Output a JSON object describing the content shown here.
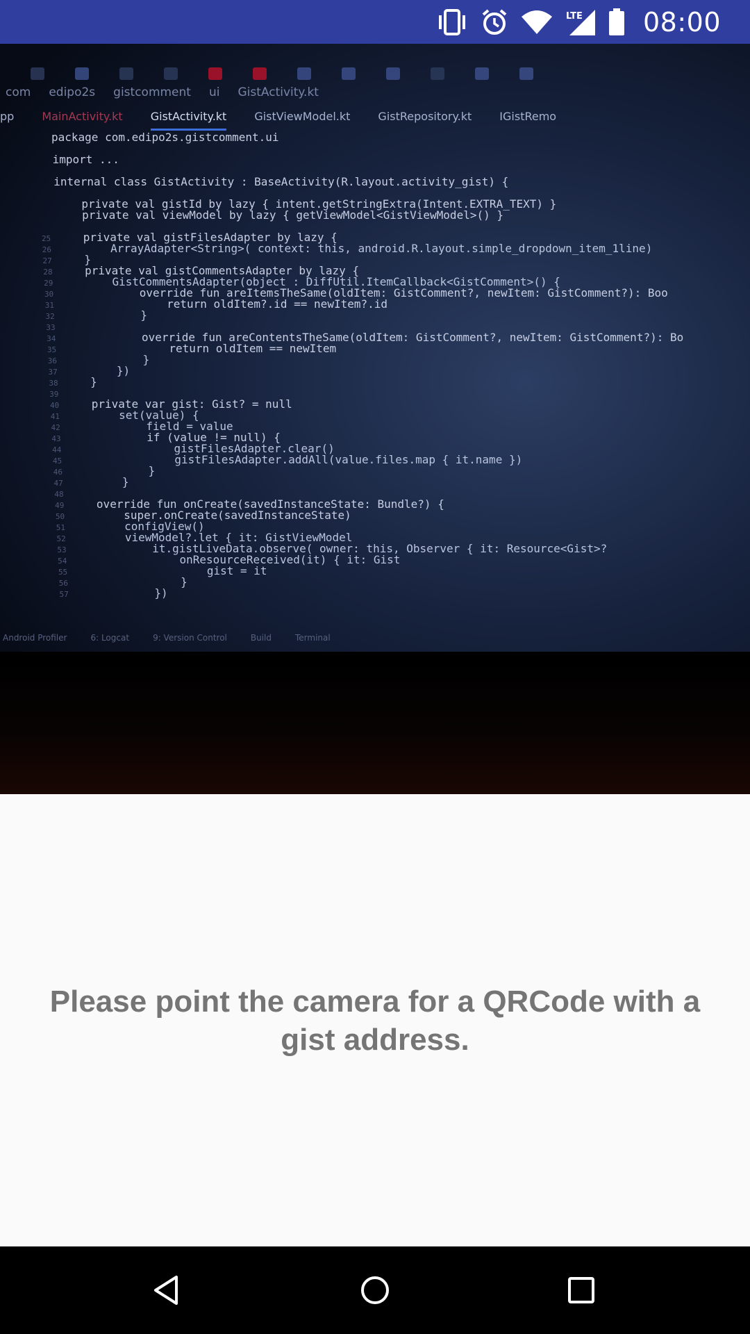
{
  "status_bar": {
    "time": "08:00",
    "icons": [
      "vibrate-icon",
      "alarm-icon",
      "wifi-icon",
      "lte-signal-icon",
      "battery-icon"
    ],
    "network_label": "LTE",
    "background_color": "#303f9f"
  },
  "camera_preview": {
    "toolbar_run_config": "app",
    "breadcrumbs": [
      "com",
      "edipo2s",
      "gistcomment",
      "ui",
      "GistActivity.kt"
    ],
    "tabs": [
      "pp",
      "MainActivity.kt",
      "GistActivity.kt",
      "GistViewModel.kt",
      "GistRepository.kt",
      "IGistRemo"
    ],
    "active_tab": "GistActivity.kt",
    "code_lines": [
      {
        "n": "",
        "text": "package com.edipo2s.gistcomment.ui"
      },
      {
        "n": "",
        "text": ""
      },
      {
        "n": "",
        "text": "import ..."
      },
      {
        "n": "",
        "text": ""
      },
      {
        "n": "",
        "text": "internal class GistActivity : BaseActivity(R.layout.activity_gist) {"
      },
      {
        "n": "",
        "text": ""
      },
      {
        "n": "",
        "text": "    private val gistId by lazy { intent.getStringExtra(Intent.EXTRA_TEXT) }"
      },
      {
        "n": "",
        "text": "    private val viewModel by lazy { getViewModel<GistViewModel>() }"
      },
      {
        "n": "",
        "text": ""
      },
      {
        "n": "25",
        "text": "    private val gistFilesAdapter by lazy {"
      },
      {
        "n": "26",
        "text": "        ArrayAdapter<String>( context: this, android.R.layout.simple_dropdown_item_1line)"
      },
      {
        "n": "27",
        "text": "    }"
      },
      {
        "n": "28",
        "text": "    private val gistCommentsAdapter by lazy {"
      },
      {
        "n": "29",
        "text": "        GistCommentsAdapter(object : DiffUtil.ItemCallback<GistComment>() {"
      },
      {
        "n": "30",
        "text": "            override fun areItemsTheSame(oldItem: GistComment?, newItem: GistComment?): Boo"
      },
      {
        "n": "31",
        "text": "                return oldItem?.id == newItem?.id"
      },
      {
        "n": "32",
        "text": "            }"
      },
      {
        "n": "33",
        "text": ""
      },
      {
        "n": "34",
        "text": "            override fun areContentsTheSame(oldItem: GistComment?, newItem: GistComment?): Bo"
      },
      {
        "n": "35",
        "text": "                return oldItem == newItem"
      },
      {
        "n": "36",
        "text": "            }"
      },
      {
        "n": "37",
        "text": "        })"
      },
      {
        "n": "38",
        "text": "    }"
      },
      {
        "n": "39",
        "text": ""
      },
      {
        "n": "40",
        "text": "    private var gist: Gist? = null"
      },
      {
        "n": "41",
        "text": "        set(value) {"
      },
      {
        "n": "42",
        "text": "            field = value"
      },
      {
        "n": "43",
        "text": "            if (value != null) {"
      },
      {
        "n": "44",
        "text": "                gistFilesAdapter.clear()"
      },
      {
        "n": "45",
        "text": "                gistFilesAdapter.addAll(value.files.map { it.name })"
      },
      {
        "n": "46",
        "text": "            }"
      },
      {
        "n": "47",
        "text": "        }"
      },
      {
        "n": "48",
        "text": ""
      },
      {
        "n": "49",
        "text": "    override fun onCreate(savedInstanceState: Bundle?) {"
      },
      {
        "n": "50",
        "text": "        super.onCreate(savedInstanceState)"
      },
      {
        "n": "51",
        "text": "        configView()"
      },
      {
        "n": "52",
        "text": "        viewModel?.let { it: GistViewModel"
      },
      {
        "n": "53",
        "text": "            it.gistLiveData.observe( owner: this, Observer { it: Resource<Gist>?"
      },
      {
        "n": "54",
        "text": "                onResourceReceived(it) { it: Gist"
      },
      {
        "n": "55",
        "text": "                    gist = it"
      },
      {
        "n": "56",
        "text": "                }"
      },
      {
        "n": "57",
        "text": "            })"
      }
    ],
    "ide_status_items": [
      "Android Profiler",
      "6: Logcat",
      "9: Version Control",
      "Build",
      "Terminal"
    ]
  },
  "message": {
    "text": "Please point the camera for a QRCode with a gist address."
  },
  "nav_bar": {
    "buttons": [
      "back-button",
      "home-button",
      "recents-button"
    ]
  }
}
